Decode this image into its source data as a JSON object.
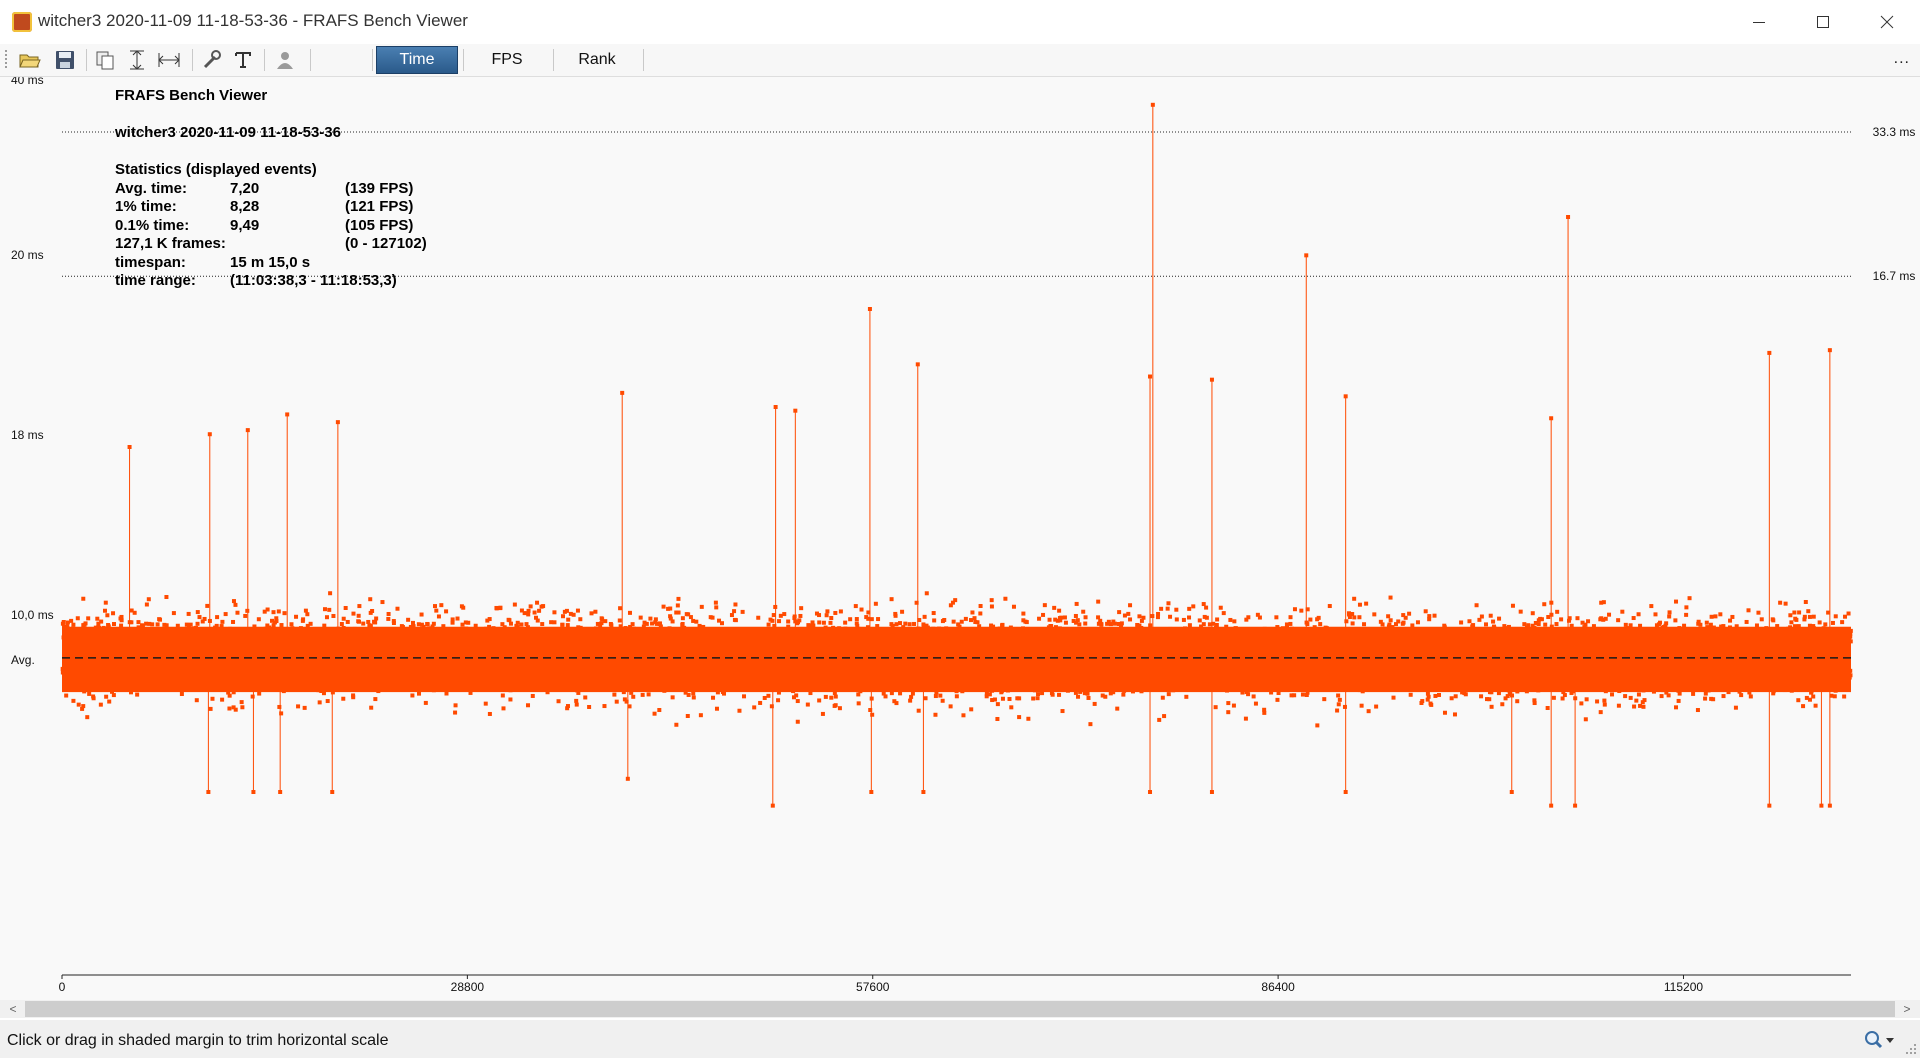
{
  "window": {
    "title": "witcher3 2020-11-09 11-18-53-36 - FRAFS Bench Viewer"
  },
  "toolbar": {
    "tabs": [
      "Time",
      "FPS",
      "Rank"
    ],
    "active_tab": "Time",
    "overflow_label": "..."
  },
  "stats": {
    "app_name": "FRAFS Bench Viewer",
    "bench_name": "witcher3 2020-11-09 11-18-53-36",
    "section_title": "Statistics (displayed events)",
    "rows": [
      {
        "label": "Avg. time:",
        "value": "7,20",
        "extra": "(139 FPS)"
      },
      {
        "label": "1% time:",
        "value": "8,28",
        "extra": "(121 FPS)"
      },
      {
        "label": "0.1% time:",
        "value": "9,49",
        "extra": "(105 FPS)"
      },
      {
        "label": "127,1 K frames:",
        "value": "",
        "extra": "(0 - 127102)"
      },
      {
        "label": "timespan:",
        "value": "15 m 15,0 s",
        "extra": ""
      },
      {
        "label": "time range:",
        "value": "(11:03:38,3 - 11:18:53,3)",
        "extra": ""
      }
    ]
  },
  "chart_data": {
    "type": "scatter",
    "y_scale": "reciprocal (frame time shown on FPS-linear scale)",
    "y_ticks": [
      "40 ms",
      "20 ms",
      "18 ms",
      "10,0 ms",
      "Avg."
    ],
    "reference_lines": [
      {
        "label": "33.3 ms",
        "value": 33.3
      },
      {
        "label": "16.7 ms",
        "value": 16.7
      }
    ],
    "avg_line": {
      "label": "Avg.",
      "value": 7.2
    },
    "x_ticks": [
      0,
      28800,
      57600,
      86400,
      115200
    ],
    "x_range": [
      0,
      127102
    ],
    "marker_color": "#ff4a00",
    "baseline_band": {
      "typical_ms_range": [
        6.5,
        8.0
      ]
    },
    "spikes": [
      {
        "x": 77500,
        "y": 41.0
      },
      {
        "x": 107000,
        "y": 21.0
      },
      {
        "x": 88400,
        "y": 18.0
      },
      {
        "x": 57400,
        "y": 15.0
      },
      {
        "x": 60800,
        "y": 12.8
      },
      {
        "x": 81700,
        "y": 12.3
      },
      {
        "x": 125600,
        "y": 13.3
      },
      {
        "x": 121300,
        "y": 13.2
      },
      {
        "x": 77300,
        "y": 12.4
      },
      {
        "x": 105800,
        "y": 11.2
      },
      {
        "x": 50700,
        "y": 11.5
      },
      {
        "x": 52100,
        "y": 11.4
      },
      {
        "x": 39800,
        "y": 11.9
      },
      {
        "x": 16000,
        "y": 11.3
      },
      {
        "x": 10500,
        "y": 10.8
      },
      {
        "x": 4800,
        "y": 10.5
      },
      {
        "x": 19600,
        "y": 11.1
      },
      {
        "x": 91200,
        "y": 11.8
      },
      {
        "x": 13200,
        "y": 10.9
      }
    ],
    "dips": [
      {
        "x": 10400,
        "y": 6.0
      },
      {
        "x": 13600,
        "y": 6.0
      },
      {
        "x": 15500,
        "y": 6.0
      },
      {
        "x": 19200,
        "y": 6.0
      },
      {
        "x": 40200,
        "y": 6.1
      },
      {
        "x": 50500,
        "y": 5.9
      },
      {
        "x": 57500,
        "y": 6.0
      },
      {
        "x": 61200,
        "y": 6.0
      },
      {
        "x": 77300,
        "y": 6.0
      },
      {
        "x": 81700,
        "y": 6.0
      },
      {
        "x": 91200,
        "y": 6.0
      },
      {
        "x": 103000,
        "y": 6.0
      },
      {
        "x": 105800,
        "y": 5.9
      },
      {
        "x": 107500,
        "y": 5.9
      },
      {
        "x": 121300,
        "y": 5.9
      },
      {
        "x": 125000,
        "y": 5.9
      },
      {
        "x": 125600,
        "y": 5.9
      }
    ]
  },
  "status_bar": {
    "message": "Click or drag in shaded margin to trim horizontal scale"
  },
  "scrollbar": {
    "left_arrow": "<",
    "right_arrow": ">"
  }
}
